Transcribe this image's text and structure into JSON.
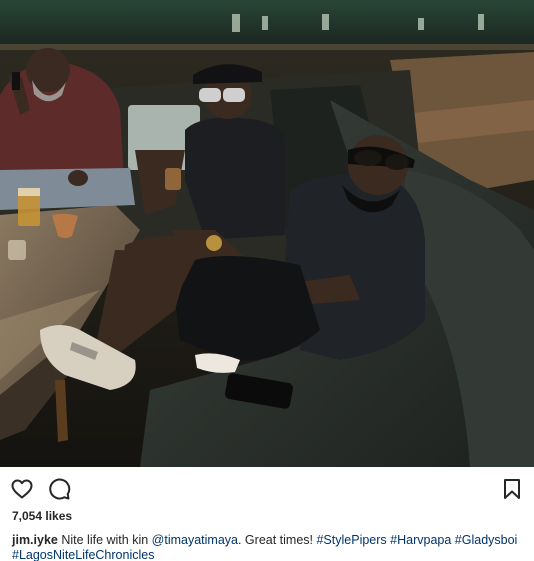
{
  "post": {
    "likes": "7,054 likes",
    "username": "jim.iyke",
    "caption_text": " Nite life with kin ",
    "mention": "@timayatimaya",
    "caption_text_2": ". Great times! ",
    "hashtags": [
      "#StylePipers",
      "#Harvpapa",
      "#Gladysboi",
      "#LagosNiteLifeChronicles"
    ]
  },
  "icons": {
    "like": "heart-outline-icon",
    "comment": "speech-bubble-icon",
    "save": "bookmark-icon"
  },
  "colors": {
    "text": "#262626",
    "link": "#003569"
  }
}
